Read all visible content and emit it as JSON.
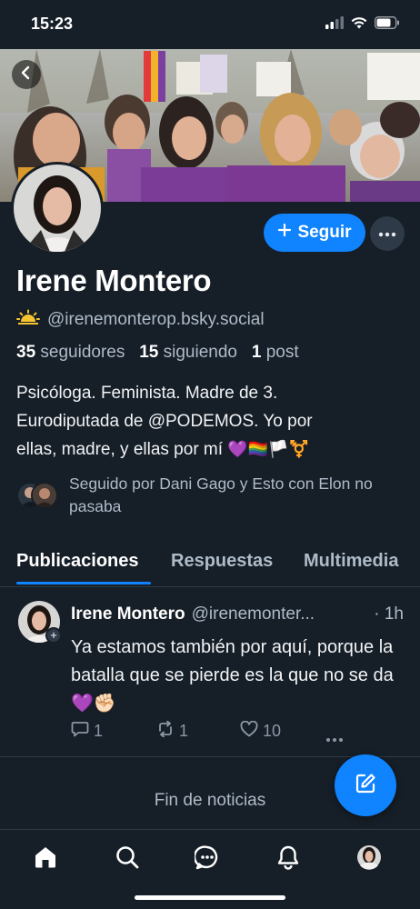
{
  "status_bar": {
    "time": "15:23"
  },
  "profile": {
    "display_name": "Irene Montero",
    "handle": "@irenemonterop.bsky.social",
    "followers_count": "35",
    "followers_label": "seguidores",
    "following_count": "15",
    "following_label": "siguiendo",
    "posts_count": "1",
    "posts_label": "post",
    "bio_line1": "Psicóloga. Feminista. Madre de 3.",
    "bio_line2": "Eurodiputada de @PODEMOS. Yo por",
    "bio_line3": "ellas, madre, y ellas por mí",
    "bio_emojis": "💜🏳️‍🌈🏳️⚧️",
    "followed_by": "Seguido por Dani Gago y Esto con Elon no pasaba"
  },
  "actions": {
    "follow_label": "Seguir"
  },
  "tabs": [
    {
      "label": "Publicaciones",
      "active": true
    },
    {
      "label": "Respuestas",
      "active": false
    },
    {
      "label": "Multimedia",
      "active": false
    }
  ],
  "post": {
    "author": "Irene Montero",
    "handle": "@irenemonter...",
    "time": "· 1h",
    "text": "Ya estamos también por aquí, porque la batalla que se pierde es la que no se da 💜✊🏻",
    "replies": "1",
    "reposts": "1",
    "likes": "10"
  },
  "feed_end": "Fin de noticias",
  "colors": {
    "accent": "#1083fe",
    "background": "#161e27",
    "muted": "#aebbc9",
    "divider": "#2e3a48"
  },
  "icons": [
    "back-arrow-icon",
    "plus-icon",
    "more-dots-icon",
    "sun-icon",
    "reply-icon",
    "repost-icon",
    "like-icon",
    "compose-icon",
    "home-icon",
    "search-icon",
    "chat-icon",
    "bell-icon"
  ]
}
